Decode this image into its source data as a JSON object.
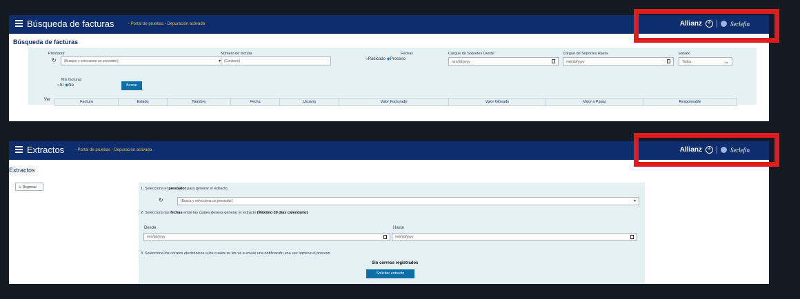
{
  "panel1": {
    "title": "Búsqueda de facturas",
    "env_note": "- Portal de pruebas - Depuración activada",
    "brand": {
      "allianz": "Allianz",
      "serlefin": "Serlefin"
    },
    "heading": "Búsqueda de facturas",
    "filters": {
      "prestador_label": "Prestador",
      "prestador_value": "(Busque y seleccione un prestador)",
      "numero_label": "Número de factura",
      "numero_placeholder": "(Contiene)",
      "fechas_label": "Fechas",
      "fechas_radicado": "Radicado",
      "fechas_proceso": "Proceso",
      "cargue_desde_label": "Cargue de Soportes Desde",
      "cargue_desde_placeholder": "mm/dd/yyyy",
      "cargue_hasta_label": "Cargue de Soportes Hasta",
      "cargue_hasta_placeholder": "mm/dd/yyyy",
      "estado_label": "Estado",
      "estado_value": "Todos",
      "mis_facturas_label": "Mis facturas",
      "mis_facturas_si": "Sí",
      "mis_facturas_no": "No",
      "buscar_label": "Buscar"
    },
    "results": {
      "ver_label": "Ver",
      "columns": [
        "Factura",
        "Estado",
        "Nombre",
        "Fecha",
        "Usuario",
        "Valor Facturado",
        "Valor Glosado",
        "Valor a Pagar",
        "Responsable"
      ]
    }
  },
  "panel2": {
    "title": "Extractos",
    "env_note": "- Portal de pruebas - Depuración activada",
    "brand": {
      "allianz": "Allianz",
      "serlefin": "Serlefin"
    },
    "heading": "Extractos",
    "regresar_label": "Regresar",
    "step1_num": "1.",
    "step1_pre": "Selecciona el",
    "step1_bold": "prestador",
    "step1_post": "para generar el extracto.",
    "prestador_value": "(Busca y selecciona un prestador)",
    "step2_num": "2.",
    "step2_pre": "Selecciona las",
    "step2_bold": "fechas",
    "step2_mid": "entre las cuales deseas generar el extracto",
    "step2_bold2": "(Máximo 30 días calendario)",
    "desde_label": "Desde",
    "desde_placeholder": "mm/dd/yyyy",
    "hasta_label": "Hasta",
    "hasta_placeholder": "mm/dd/yyyy",
    "step3": "3. Selecciona los correos electrónicos a los cuales se les va a enviar una notificación una vez termine el proceso",
    "sin_correos": "Sin correos registrados",
    "solicitar_label": "Solicitar extracto"
  }
}
